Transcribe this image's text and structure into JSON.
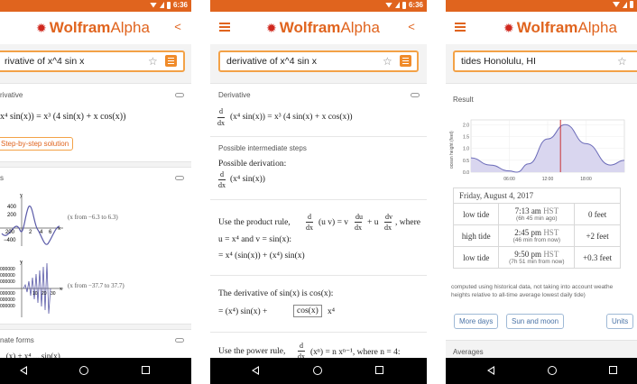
{
  "status": {
    "time": "6:36"
  },
  "app": {
    "logo_word_a": "Wolfram",
    "logo_word_b": "Alpha"
  },
  "screen1": {
    "query": "rivative of x^4 sin x",
    "pod_derivative_title": "rivative",
    "derivative_lhs": "x⁴ sin(x)) = x³ (4 sin(x) + x cos(x))",
    "step_button": "Step-by-step solution",
    "plots_title": "s",
    "plot1_caption": "(x from −6.3 to 6.3)",
    "plot1_ticks": {
      "y": "y",
      "t400": "400",
      "t200": "200",
      "t0": "200",
      "tm400": "−400",
      "x2": "2",
      "x4": "4",
      "x6": "6",
      "x": "x"
    },
    "plot2_caption": "(x from −37.7 to 37.7)",
    "plot2_ticks": {
      "y": "y",
      "a": "000000",
      "b": "000000",
      "c": "000000",
      "d": "000000",
      "e": "000000",
      "f": "000000",
      "x10": "10",
      "x20": "20",
      "x30": "30",
      "x": "x"
    },
    "alt_forms_title": "nate forms",
    "alt_forms_preview": "...(x) + x⁴ ... sin(x)"
  },
  "screen2": {
    "query": "derivative of x^4 sin x",
    "pod_derivative_title": "Derivative",
    "derivative_expr": "(x⁴ sin(x)) = x³ (4 sin(x) + x cos(x))",
    "steps_title": "Possible intermediate steps",
    "possible_derivation": "Possible derivation:",
    "pd_expr": "(x⁴ sin(x))",
    "product_rule_a": "Use the product rule,",
    "product_rule_b": "(u v) = v",
    "product_rule_c": "+ u",
    "product_rule_d": ", where",
    "product_rule_line2": "u = x⁴ and v = sin(x):",
    "product_rule_result": "= x⁴ (sin(x)) + (x⁴) sin(x)",
    "cos_text": "The derivative of sin(x) is cos(x):",
    "cos_result_a": "= (x⁴) sin(x) +",
    "cos_box": "cos(x)",
    "cos_result_b": "x⁴",
    "power_rule": "Use the power rule,",
    "power_rule_b": "(xⁿ) = n xⁿ⁻¹, where n = 4:",
    "d": "d",
    "dx": "dx",
    "du": "du",
    "dv": "dv"
  },
  "screen3": {
    "query": "tides Honolulu, HI",
    "result_title": "Result",
    "chart_ylabel": "ocean height (feet)",
    "date_header": "Friday, August 4, 2017",
    "rows": [
      {
        "type": "low tide",
        "time": "7:13 am",
        "tz": "HST",
        "rel": "(6h 45 min ago)",
        "height": "0 feet"
      },
      {
        "type": "high tide",
        "time": "2:45 pm",
        "tz": "HST",
        "rel": "(46 min from now)",
        "height": "+2 feet"
      },
      {
        "type": "low tide",
        "time": "9:50 pm",
        "tz": "HST",
        "rel": "(7h 51 min from now)",
        "height": "+0.3 feet"
      }
    ],
    "note_line1": "computed using historical data, not taking into account weathe",
    "note_line2": "heights relative to all-time average lowest daily tide)",
    "btn_more_days": "More days",
    "btn_sun_moon": "Sun and moon",
    "btn_units": "Units",
    "averages_title": "Averages"
  },
  "chart_data": {
    "type": "area",
    "ylabel": "ocean height (feet)",
    "ylim": [
      0,
      2.2
    ],
    "y_ticks": [
      "0.0",
      "0.5",
      "1.0",
      "1.5",
      "2.0"
    ],
    "x_ticks": [
      "06:00",
      "12:00",
      "18:00"
    ],
    "x": [
      "00:00",
      "03:00",
      "06:00",
      "07:13",
      "09:00",
      "12:00",
      "14:45",
      "18:00",
      "21:50",
      "24:00"
    ],
    "values": [
      0.6,
      0.3,
      0.05,
      0.0,
      0.35,
      1.4,
      2.0,
      1.2,
      0.3,
      0.5
    ],
    "current_time_marker": "14:00",
    "colors": {
      "fill": "#d9d6ef",
      "line": "#6a6ab8",
      "marker": "#c82020"
    }
  }
}
